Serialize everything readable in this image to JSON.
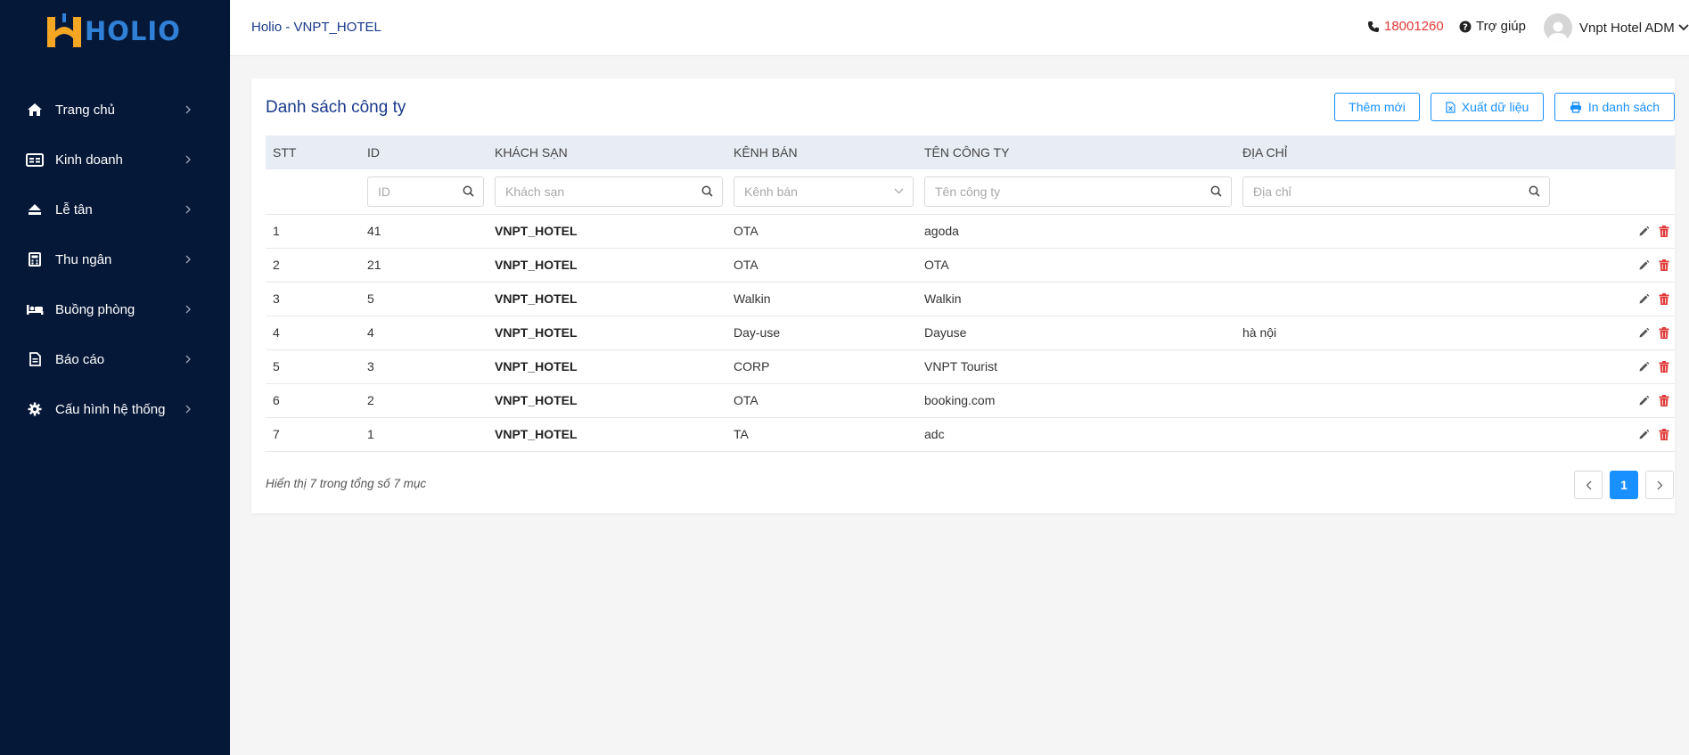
{
  "brand": {
    "name": "HOLIO"
  },
  "sidebar": {
    "items": [
      {
        "label": "Trang chủ",
        "icon": "home-icon"
      },
      {
        "label": "Kinh doanh",
        "icon": "id-card-icon"
      },
      {
        "label": "Lễ tân",
        "icon": "eject-icon"
      },
      {
        "label": "Thu ngân",
        "icon": "calculator-icon"
      },
      {
        "label": "Buồng phòng",
        "icon": "bed-icon"
      },
      {
        "label": "Báo cáo",
        "icon": "document-icon"
      },
      {
        "label": "Cấu hình hệ thống",
        "icon": "gear-icon"
      }
    ]
  },
  "header": {
    "breadcrumb": "Holio - VNPT_HOTEL",
    "hotline": "18001260",
    "help": "Trợ giúp",
    "user": "Vnpt Hotel ADM"
  },
  "page": {
    "title": "Danh sách công ty",
    "buttons": {
      "add": "Thêm mới",
      "export": "Xuất dữ liệu",
      "print": "In danh sách"
    }
  },
  "table": {
    "columns": [
      "STT",
      "ID",
      "KHÁCH SẠN",
      "KÊNH BÁN",
      "TÊN CÔNG TY",
      "ĐỊA CHỈ"
    ],
    "filters": {
      "id": "ID",
      "hotel": "Khách sạn",
      "channel": "Kênh bán",
      "company": "Tên công ty",
      "address": "Địa chỉ"
    },
    "rows": [
      {
        "stt": "1",
        "id": "41",
        "hotel": "VNPT_HOTEL",
        "channel": "OTA",
        "company": "agoda",
        "address": ""
      },
      {
        "stt": "2",
        "id": "21",
        "hotel": "VNPT_HOTEL",
        "channel": "OTA",
        "company": "OTA",
        "address": ""
      },
      {
        "stt": "3",
        "id": "5",
        "hotel": "VNPT_HOTEL",
        "channel": "Walkin",
        "company": "Walkin",
        "address": ""
      },
      {
        "stt": "4",
        "id": "4",
        "hotel": "VNPT_HOTEL",
        "channel": "Day-use",
        "company": "Dayuse",
        "address": "hà nội"
      },
      {
        "stt": "5",
        "id": "3",
        "hotel": "VNPT_HOTEL",
        "channel": "CORP",
        "company": "VNPT Tourist",
        "address": ""
      },
      {
        "stt": "6",
        "id": "2",
        "hotel": "VNPT_HOTEL",
        "channel": "OTA",
        "company": "booking.com",
        "address": ""
      },
      {
        "stt": "7",
        "id": "1",
        "hotel": "VNPT_HOTEL",
        "channel": "TA",
        "company": "adc",
        "address": ""
      }
    ]
  },
  "pagination": {
    "summary": "Hiển thị 7 trong tổng số 7 mục",
    "current": "1"
  },
  "colors": {
    "sidebar": "#061838",
    "accent": "#1890ff",
    "title": "#1a3a8a",
    "danger": "#e03a3a",
    "logo_orange": "#f5a623",
    "logo_blue": "#2f80d6"
  }
}
